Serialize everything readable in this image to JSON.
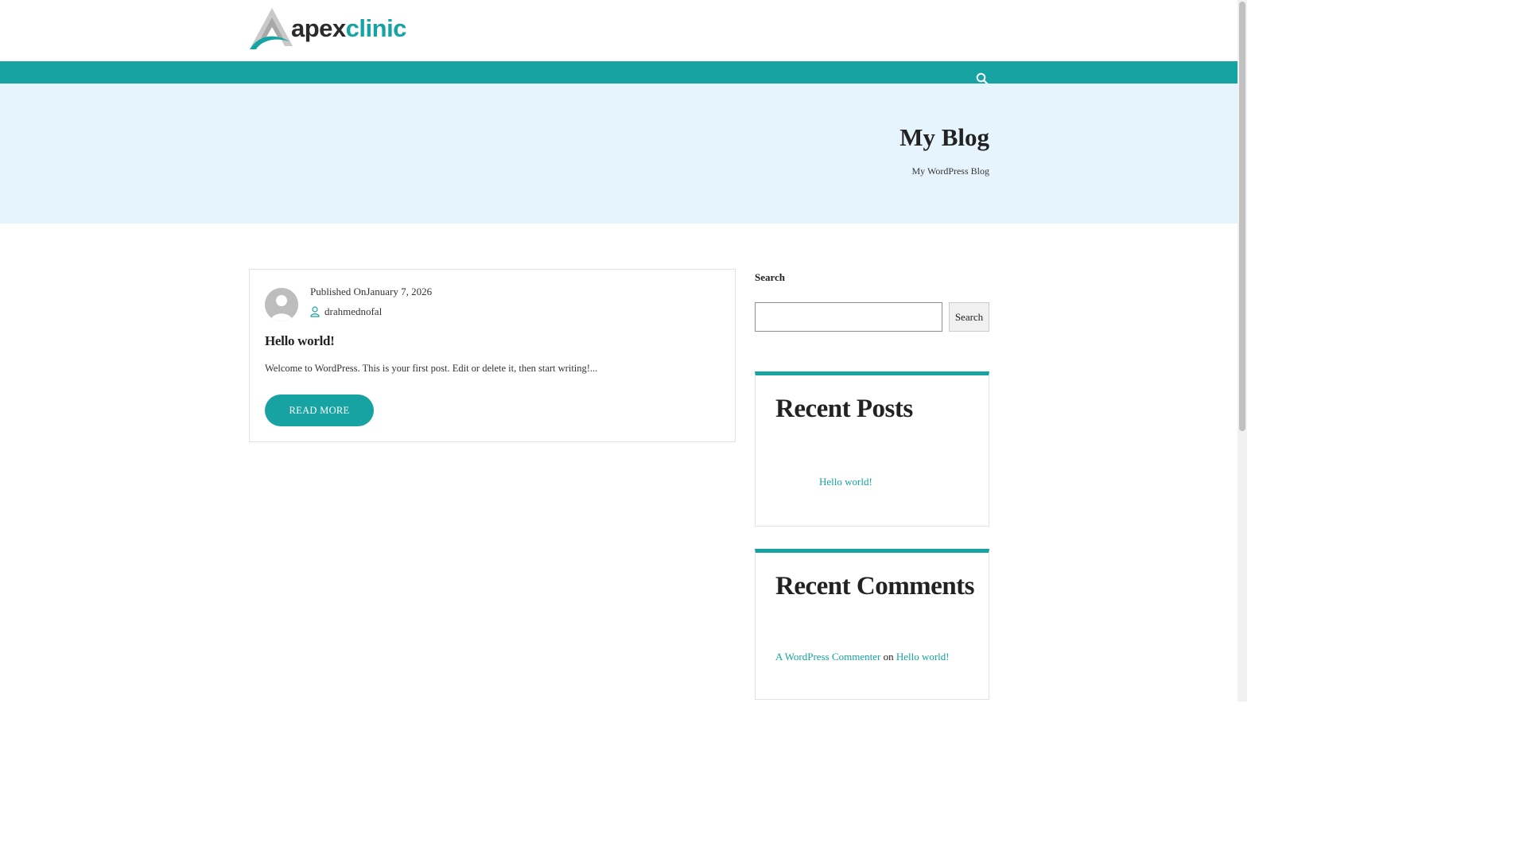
{
  "brand": {
    "name_part1": "apex",
    "name_part2": "clinic",
    "accent_color": "#16a3a1",
    "hero_bg": "#e6f5fd"
  },
  "nav": {
    "search_icon": "search-icon"
  },
  "hero": {
    "title": "My Blog",
    "subtitle": "My WordPress Blog"
  },
  "post": {
    "published_prefix": "Published On",
    "published_date": "January 7, 2026",
    "author_icon": "user-icon",
    "author": "drahmednofal",
    "title": "Hello world!",
    "excerpt": "Welcome to WordPress. This is your first post. Edit or delete it, then start writing!...",
    "read_more_label": "READ MORE"
  },
  "sidebar": {
    "search": {
      "label": "Search",
      "input_value": "",
      "button_label": "Search"
    },
    "recent_posts": {
      "title": "Recent Posts",
      "items": [
        "Hello world!"
      ]
    },
    "recent_comments": {
      "title": "Recent Comments",
      "items": [
        {
          "author": "A WordPress Commenter",
          "connector": "on",
          "post": "Hello world!"
        }
      ]
    }
  }
}
